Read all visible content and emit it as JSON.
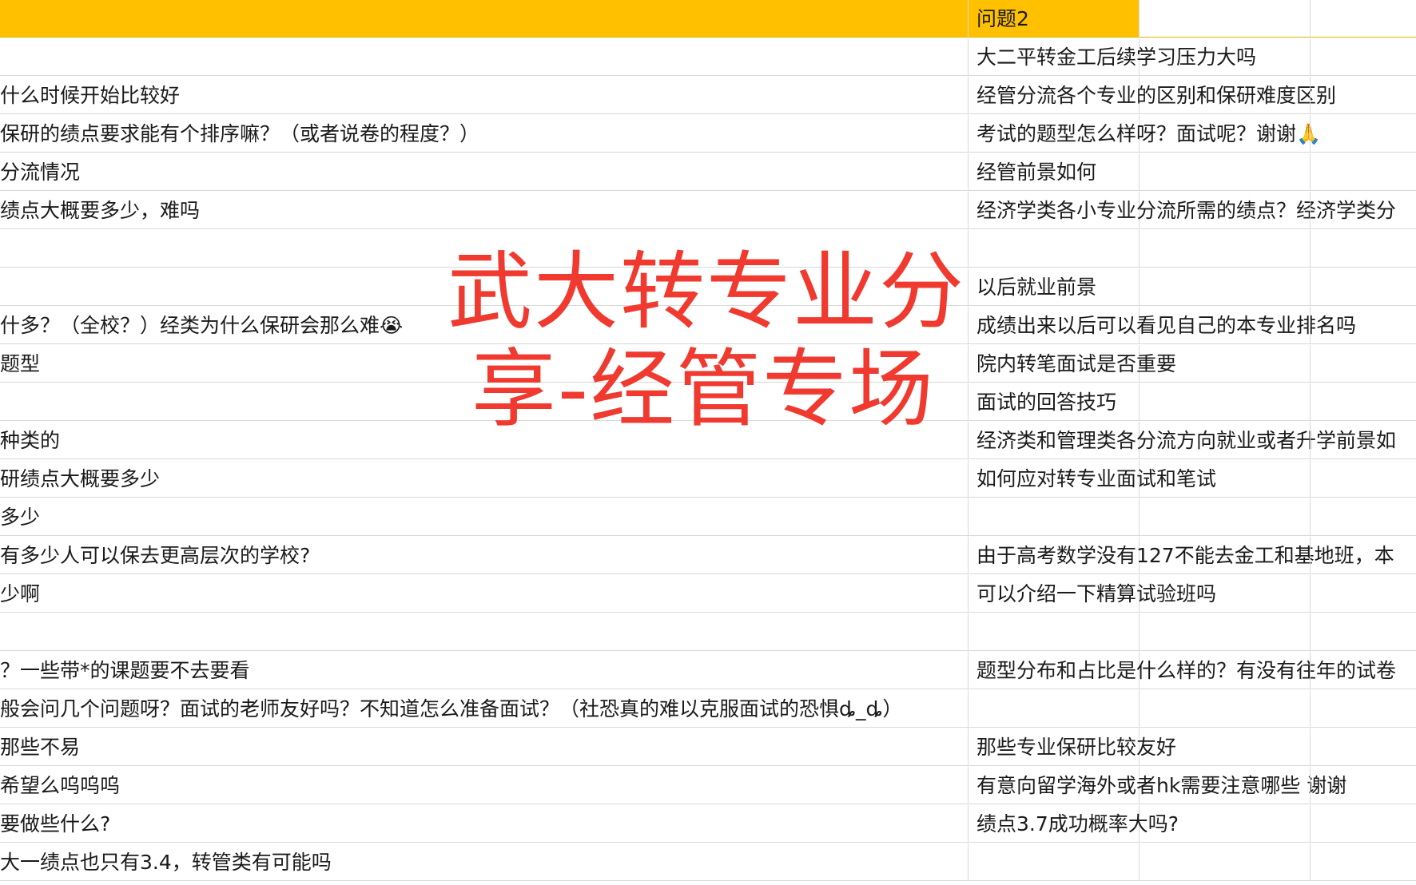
{
  "header": {
    "col_b_title": "问题2"
  },
  "rows": [
    {
      "a": "",
      "b": "大二平转金工后续学习压力大吗"
    },
    {
      "a": "什么时候开始比较好",
      "b": "经管分流各个专业的区别和保研难度区别"
    },
    {
      "a": "保研的绩点要求能有个排序嘛？（或者说卷的程度？）",
      "b": "考试的题型怎么样呀？面试呢？谢谢🙏"
    },
    {
      "a": "分流情况",
      "b": "经管前景如何"
    },
    {
      "a": "绩点大概要多少，难吗",
      "b": "经济学类各小专业分流所需的绩点？经济学类分"
    },
    {
      "a": "",
      "b": ""
    },
    {
      "a": "",
      "b": "以后就业前景"
    },
    {
      "a": "什多？（全校？）经类为什么保研会那么难😭",
      "b": "成绩出来以后可以看见自己的本专业排名吗"
    },
    {
      "a": "题型",
      "b": "院内转笔面试是否重要"
    },
    {
      "a": "",
      "b": "面试的回答技巧"
    },
    {
      "a": "种类的",
      "b": "经济类和管理类各分流方向就业或者升学前景如"
    },
    {
      "a": "研绩点大概要多少",
      "b": "如何应对转专业面试和笔试"
    },
    {
      "a": "多少",
      "b": ""
    },
    {
      "a": "有多少人可以保去更高层次的学校?",
      "b": "由于高考数学没有127不能去金工和基地班，本"
    },
    {
      "a": "少啊",
      "b": "可以介绍一下精算试验班吗"
    },
    {
      "a": "",
      "b": ""
    },
    {
      "a": "？一些带*的课题要不去要看",
      "b": "题型分布和占比是什么样的？有没有往年的试卷"
    },
    {
      "a": "般会问几个问题呀？面试的老师友好吗？不知道怎么准备面试？（社恐真的难以克服面试的恐惧ȡ_ȡ）",
      "b": ""
    },
    {
      "a": "那些不易",
      "b": "那些专业保研比较友好"
    },
    {
      "a": "希望么呜呜呜",
      "b": "有意向留学海外或者hk需要注意哪些 谢谢"
    },
    {
      "a": "要做些什么?",
      "b": "绩点3.7成功概率大吗?"
    },
    {
      "a": "大一绩点也只有3.4，转管类有可能吗",
      "b": ""
    }
  ],
  "overlay": {
    "line1": "武大转专业分",
    "line2": "享-经管专场"
  },
  "colors": {
    "header": "#ffc000",
    "overlay_text": "#f03a30",
    "grid": "#d9d9d9"
  }
}
